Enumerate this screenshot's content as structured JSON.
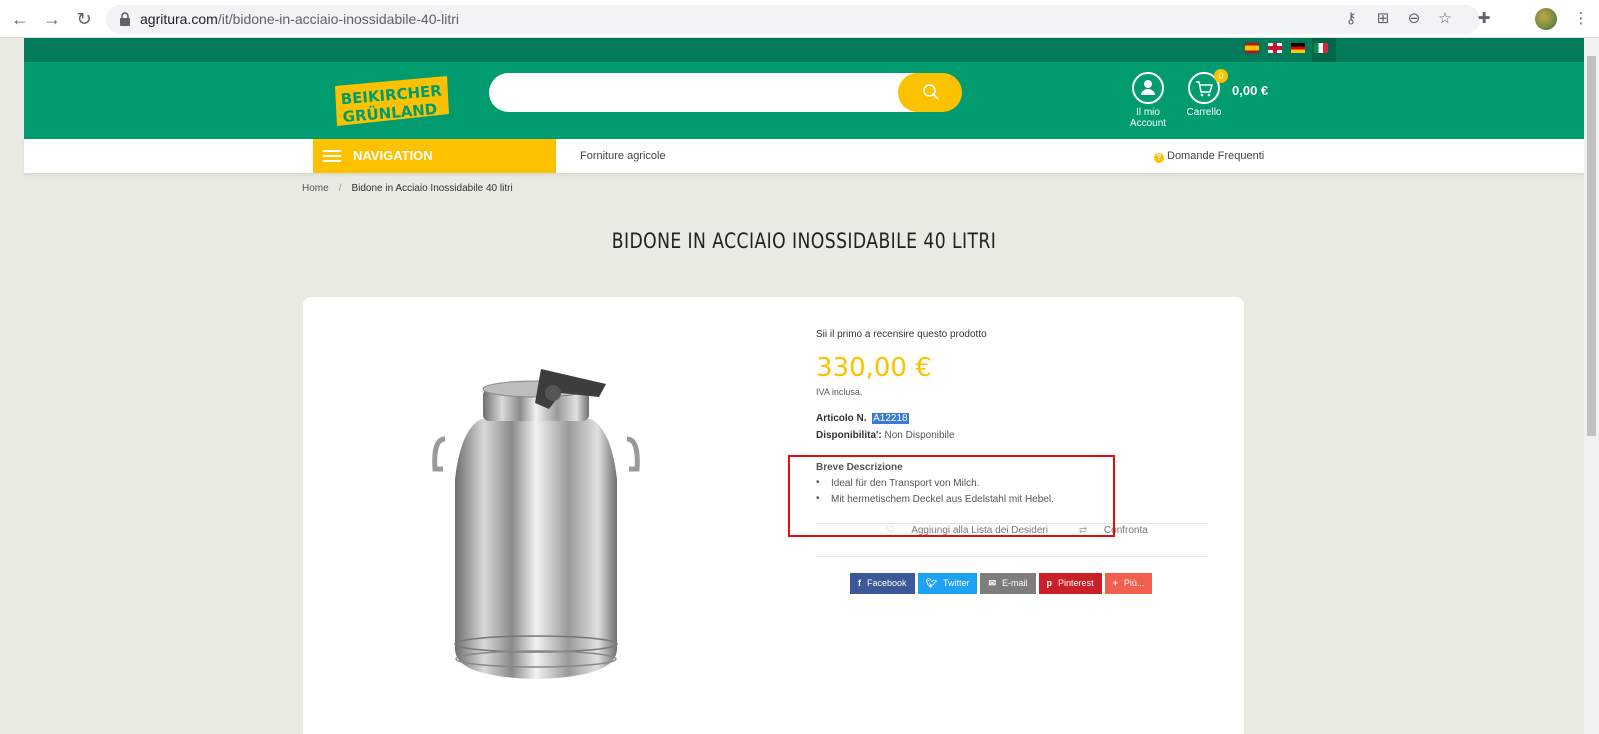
{
  "browser": {
    "url_host": "agritura.com",
    "url_path": "/it/bidone-in-acciaio-inossidabile-40-litri"
  },
  "header": {
    "logo_line1": "BEIKIRCHER",
    "logo_line2": "GRÜNLAND",
    "account_label": "Il mio Account",
    "cart_label": "Carrello",
    "cart_count": "0",
    "cart_total": "0,00 €",
    "languages": [
      "es",
      "en",
      "de",
      "it"
    ]
  },
  "nav": {
    "navigation_label": "NAVIGATION",
    "link_supplies": "Forniture agricole",
    "link_faq": "Domande Frequenti"
  },
  "breadcrumb": {
    "home": "Home",
    "separator": "/",
    "current": "Bidone in Acciaio Inossidabile 40 litri"
  },
  "product": {
    "title": "BIDONE IN ACCIAIO INOSSIDABILE 40 LITRI",
    "review_prompt": "Sii il primo a recensire questo prodotto",
    "price": "330,00 €",
    "vat_note": "IVA inclusa.",
    "sku_label": "Articolo N.",
    "sku_value": "A12218",
    "availability_label": "Disponibilita':",
    "availability_value": "Non Disponibile",
    "short_desc_title": "Breve Descrizione",
    "short_desc_items": [
      "Ideal für den Transport von Milch.",
      "Mit hermetischem Deckel aus Edelstahl mit Hebel."
    ],
    "wishlist_label": "Aggiungi alla Lista dei Desideri",
    "compare_label": "Confronta"
  },
  "share": {
    "facebook": "Facebook",
    "twitter": "Twitter",
    "email": "E-mail",
    "pinterest": "Pinterest",
    "more": "Più...",
    "colors": {
      "facebook": "#3b5998",
      "twitter": "#1da1f2",
      "email": "#7d7d7d",
      "pinterest": "#cb2027",
      "more": "#f25f4c"
    }
  },
  "colors": {
    "brand_green": "#009c6f",
    "brand_yellow": "#fcc200",
    "annotation_red": "#e01010"
  }
}
